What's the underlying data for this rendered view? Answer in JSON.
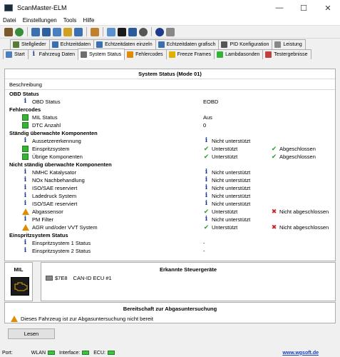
{
  "window": {
    "title": "ScanMaster-ELM",
    "minimize": "—",
    "maximize": "☐",
    "close": "✕"
  },
  "menu": [
    "Datei",
    "Einstellungen",
    "Tools",
    "Hilfe"
  ],
  "tabs_top": [
    {
      "label": "Stellglieder",
      "icon_color": "#5a7a3a"
    },
    {
      "label": "Echtzeitdaten",
      "icon_color": "#3a6fb0"
    },
    {
      "label": "Echtzeitdaten einzeln",
      "icon_color": "#3a6fb0"
    },
    {
      "label": "Echtzeitdaten grafisch",
      "icon_color": "#3a6fb0"
    },
    {
      "label": "PID Konfiguration",
      "icon_color": "#555555"
    },
    {
      "label": "Leistung",
      "icon_color": "#888888"
    }
  ],
  "tabs_bottom": [
    {
      "label": "Start",
      "icon_color": "#4a7fc0"
    },
    {
      "label": "Fahrzeug Daten",
      "icon_color": "#1c3a8c"
    },
    {
      "label": "System Status",
      "icon_color": "#6e6e6e"
    },
    {
      "label": "Fehlercodes",
      "icon_color": "#e08b00"
    },
    {
      "label": "Freeze Frames",
      "icon_color": "#e0b000"
    },
    {
      "label": "Lambdasonden",
      "icon_color": "#36b336"
    },
    {
      "label": "Testergebnisse",
      "icon_color": "#c04040"
    }
  ],
  "status": {
    "title": "System Status (Mode 01)",
    "column_header": "Beschreibung",
    "sections": [
      {
        "title": "OBD Status",
        "rows": [
          {
            "icon": "info",
            "label": "OBD Status",
            "value": "EOBD"
          }
        ]
      },
      {
        "title": "Fehlercodes",
        "rows": [
          {
            "icon": "green",
            "label": "MIL Status",
            "value": "Aus"
          },
          {
            "icon": "green",
            "label": "DTC Anzahl",
            "value": "0"
          }
        ]
      },
      {
        "title": "Ständig überwachte Komponenten",
        "rows": [
          {
            "icon": "info",
            "label": "Aussetzererkennung",
            "s_icon": "info",
            "s": "Nicht unterstützt",
            "c_icon": "",
            "c": ""
          },
          {
            "icon": "green",
            "label": "Einspritzsystem",
            "s_icon": "check",
            "s": "Unterstützt",
            "c_icon": "check",
            "c": "Abgeschlossen"
          },
          {
            "icon": "green",
            "label": "Übrige Komponenten",
            "s_icon": "check",
            "s": "Unterstützt",
            "c_icon": "check",
            "c": "Abgeschlossen"
          }
        ]
      },
      {
        "title": "Nicht ständig überwachte Komponenten",
        "rows": [
          {
            "icon": "info",
            "label": "NMHC Katalysator",
            "s_icon": "info",
            "s": "Nicht unterstützt",
            "c_icon": "",
            "c": ""
          },
          {
            "icon": "info",
            "label": "NOx Nachbehandlung",
            "s_icon": "info",
            "s": "Nicht unterstützt",
            "c_icon": "",
            "c": ""
          },
          {
            "icon": "info",
            "label": "ISO/SAE reserviert",
            "s_icon": "info",
            "s": "Nicht unterstützt",
            "c_icon": "",
            "c": ""
          },
          {
            "icon": "info",
            "label": "Ladedruck System",
            "s_icon": "info",
            "s": "Nicht unterstützt",
            "c_icon": "",
            "c": ""
          },
          {
            "icon": "info",
            "label": "ISO/SAE reserviert",
            "s_icon": "info",
            "s": "Nicht unterstützt",
            "c_icon": "",
            "c": ""
          },
          {
            "icon": "warn",
            "label": "Abgassensor",
            "s_icon": "check",
            "s": "Unterstützt",
            "c_icon": "cross",
            "c": "Nicht abgeschlossen"
          },
          {
            "icon": "info",
            "label": "PM Filter",
            "s_icon": "info",
            "s": "Nicht unterstützt",
            "c_icon": "",
            "c": ""
          },
          {
            "icon": "warn",
            "label": "AGR und/oder VVT System",
            "s_icon": "check",
            "s": "Unterstützt",
            "c_icon": "cross",
            "c": "Nicht abgeschlossen"
          }
        ]
      },
      {
        "title": "Einspritzsystem Status",
        "rows": [
          {
            "icon": "info",
            "label": "Einspritzsystem 1 Status",
            "value": "-"
          },
          {
            "icon": "info",
            "label": "Einspritzsystem 2 Status",
            "value": "-"
          }
        ]
      }
    ]
  },
  "mil": {
    "label": "MIL"
  },
  "ecus": {
    "title": "Erkannte Steuergeräte",
    "items": [
      {
        "id": "$7E8",
        "name": "CAN-ID ECU #1"
      }
    ]
  },
  "readiness": {
    "title": "Bereitschaft zur Abgasuntersuchung",
    "message": "Dieses Fahrzeug ist zur Abgasuntersuchung nicht bereit"
  },
  "read_button": "Lesen",
  "statusbar": {
    "port": "Port:",
    "wlan": "WLAN",
    "interface": "Interface:",
    "ecu": "ECU:",
    "link": "www.wgsoft.de"
  }
}
